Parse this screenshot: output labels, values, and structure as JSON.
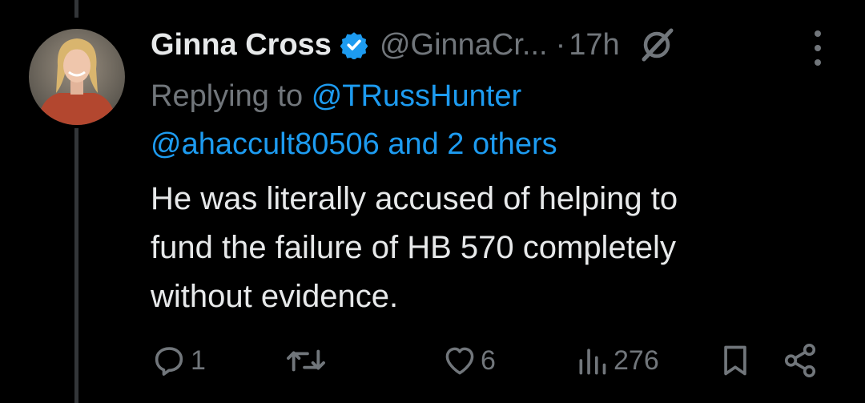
{
  "tweet": {
    "author_name": "Ginna Cross",
    "author_handle": "@GinnaCr...",
    "separator": "·",
    "time": "17h",
    "replying_to_label": "Replying to",
    "replying_to_first": "@TRussHunter",
    "replying_to_second": "@ahaccult80506",
    "replying_to_others": "and 2 others",
    "body_lines": [
      "He was literally accused of helping to",
      "fund the failure of HB 570 completely",
      "without evidence."
    ]
  },
  "actions": {
    "replies": "1",
    "reposts": "",
    "likes": "6",
    "views": "276"
  },
  "icons": {
    "verified": "verified-badge-icon",
    "grok": "grok-icon",
    "more": "more-dots-icon",
    "reply": "reply-icon",
    "repost": "repost-icon",
    "like": "heart-icon",
    "views": "views-chart-icon",
    "bookmark": "bookmark-icon",
    "share": "share-icon"
  },
  "colors": {
    "background": "#000000",
    "text_primary": "#e7e9ea",
    "text_secondary": "#71767b",
    "accent": "#1d9bf0",
    "thread_line": "#333639"
  }
}
